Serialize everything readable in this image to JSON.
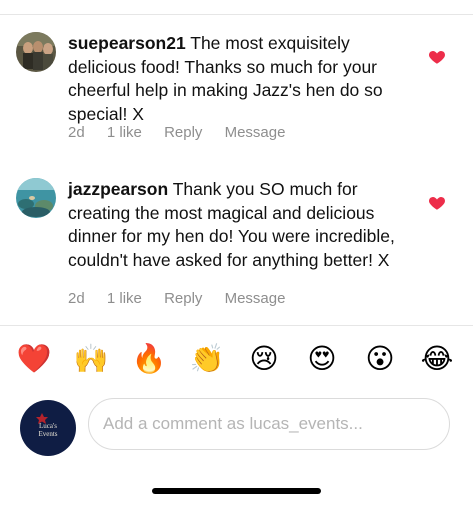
{
  "comments": [
    {
      "username": "suepearson21",
      "text": "The most exquisitely delicious food!  Thanks so much for your cheerful help in making Jazz's hen do so special! X",
      "age": "2d",
      "likes": "1 like",
      "reply": "Reply",
      "message": "Message",
      "liked": true
    },
    {
      "username": "jazzpearson",
      "text": "Thank you SO much for creating the most magical and delicious dinner for my hen do! You were incredible, couldn't have asked for anything better! X",
      "age": "2d",
      "likes": "1 like",
      "reply": "Reply",
      "message": "Message",
      "liked": true
    }
  ],
  "emoji_bar": [
    {
      "name": "red-heart",
      "glyph": "❤️"
    },
    {
      "name": "raising-hands",
      "glyph": "🙌"
    },
    {
      "name": "fire",
      "glyph": "🔥"
    },
    {
      "name": "clapping-hands",
      "glyph": "👏"
    },
    {
      "name": "crying-face",
      "glyph": "😢"
    },
    {
      "name": "heart-eyes-face",
      "glyph": "😍"
    },
    {
      "name": "surprised-face",
      "glyph": "😮"
    },
    {
      "name": "tears-of-joy-face",
      "glyph": "😂"
    }
  ],
  "composer": {
    "placeholder": "Add a comment as lucas_events...",
    "avatar_brand": "Luca's\nEvents"
  },
  "colors": {
    "heart": "#ed2d4a",
    "muted_text": "#8e8e8e",
    "avatar_navy": "#0f1d44"
  }
}
